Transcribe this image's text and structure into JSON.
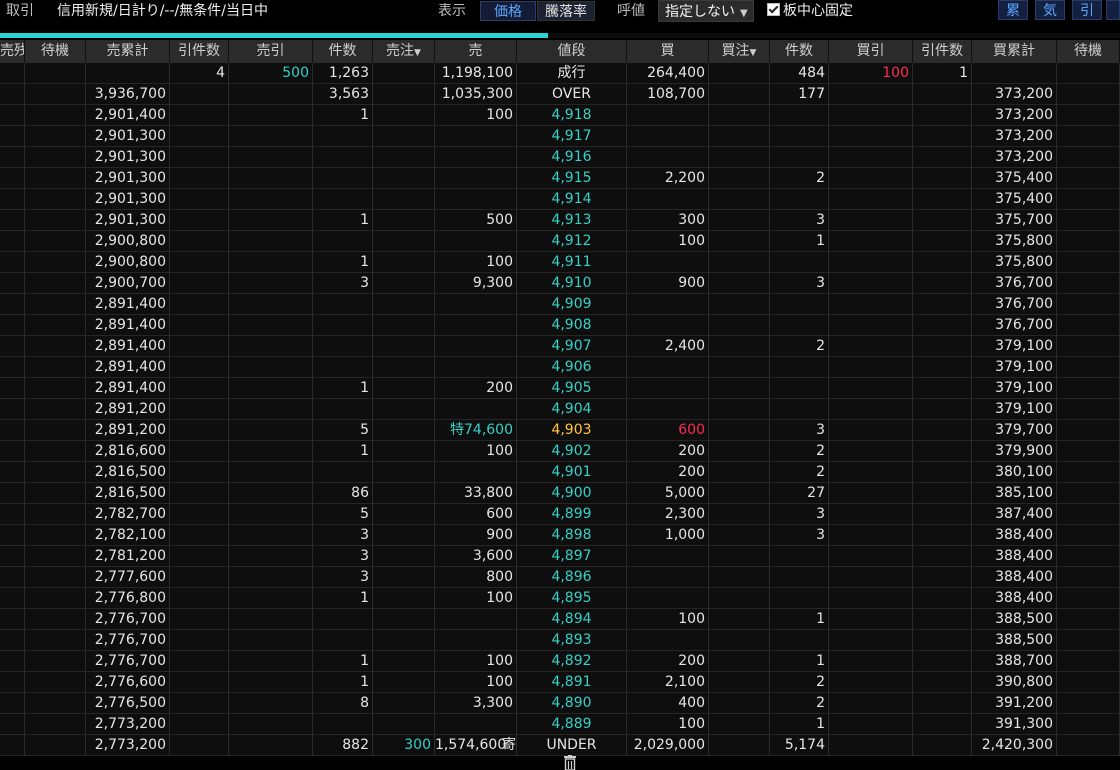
{
  "toolbar": {
    "trade_label": "取引",
    "trade_value": "信用新規/日計り/--/無条件/当日中",
    "display_label": "表示",
    "display_opt_price": "価格",
    "display_opt_rate": "騰落率",
    "tick_label": "呼値",
    "tick_value": "指定しない",
    "center_fix_label": "板中心固定",
    "btn_cumulative": "累",
    "btn_volume": "気",
    "btn_draw": "引"
  },
  "headers": {
    "sell_rest": "売残",
    "wait_l": "待機",
    "sell_cum": "売累計",
    "draw_count_l": "引件数",
    "sell_draw": "売引",
    "count_l": "件数",
    "sell_order": "売注",
    "sell": "売",
    "price": "値段",
    "buy": "買",
    "buy_order": "買注",
    "count_r": "件数",
    "buy_draw": "買引",
    "draw_count_r": "引件数",
    "buy_cum": "買累計",
    "wait_r": "待機"
  },
  "top_row": {
    "draw_count_l": "4",
    "sell_draw": "500",
    "count_l": "1,263",
    "sell": "1,198,100",
    "price": "成行",
    "buy": "264,400",
    "count_r": "484",
    "buy_draw": "100",
    "draw_count_r": "1"
  },
  "over_row": {
    "sell_cum": "3,936,700",
    "count_l": "3,563",
    "sell": "1,035,300",
    "price": "OVER",
    "buy": "108,700",
    "count_r": "177",
    "buy_cum": "373,200"
  },
  "levels": [
    {
      "sell_cum": "2,901,400",
      "count_l": "1",
      "sell": "100",
      "price": "4,918",
      "buy": "",
      "count_r": "",
      "buy_cum": "373,200"
    },
    {
      "sell_cum": "2,901,300",
      "count_l": "",
      "sell": "",
      "price": "4,917",
      "buy": "",
      "count_r": "",
      "buy_cum": "373,200"
    },
    {
      "sell_cum": "2,901,300",
      "count_l": "",
      "sell": "",
      "price": "4,916",
      "buy": "",
      "count_r": "",
      "buy_cum": "373,200"
    },
    {
      "sell_cum": "2,901,300",
      "count_l": "",
      "sell": "",
      "price": "4,915",
      "buy": "2,200",
      "count_r": "2",
      "buy_cum": "375,400"
    },
    {
      "sell_cum": "2,901,300",
      "count_l": "",
      "sell": "",
      "price": "4,914",
      "buy": "",
      "count_r": "",
      "buy_cum": "375,400"
    },
    {
      "sell_cum": "2,901,300",
      "count_l": "1",
      "sell": "500",
      "price": "4,913",
      "buy": "300",
      "count_r": "3",
      "buy_cum": "375,700"
    },
    {
      "sell_cum": "2,900,800",
      "count_l": "",
      "sell": "",
      "price": "4,912",
      "buy": "100",
      "count_r": "1",
      "buy_cum": "375,800"
    },
    {
      "sell_cum": "2,900,800",
      "count_l": "1",
      "sell": "100",
      "price": "4,911",
      "buy": "",
      "count_r": "",
      "buy_cum": "375,800"
    },
    {
      "sell_cum": "2,900,700",
      "count_l": "3",
      "sell": "9,300",
      "price": "4,910",
      "buy": "900",
      "count_r": "3",
      "buy_cum": "376,700"
    },
    {
      "sell_cum": "2,891,400",
      "count_l": "",
      "sell": "",
      "price": "4,909",
      "buy": "",
      "count_r": "",
      "buy_cum": "376,700"
    },
    {
      "sell_cum": "2,891,400",
      "count_l": "",
      "sell": "",
      "price": "4,908",
      "buy": "",
      "count_r": "",
      "buy_cum": "376,700"
    },
    {
      "sell_cum": "2,891,400",
      "count_l": "",
      "sell": "",
      "price": "4,907",
      "buy": "2,400",
      "count_r": "2",
      "buy_cum": "379,100"
    },
    {
      "sell_cum": "2,891,400",
      "count_l": "",
      "sell": "",
      "price": "4,906",
      "buy": "",
      "count_r": "",
      "buy_cum": "379,100"
    },
    {
      "sell_cum": "2,891,400",
      "count_l": "1",
      "sell": "200",
      "price": "4,905",
      "buy": "",
      "count_r": "",
      "buy_cum": "379,100"
    },
    {
      "sell_cum": "2,891,200",
      "count_l": "",
      "sell": "",
      "price": "4,904",
      "buy": "",
      "count_r": "",
      "buy_cum": "379,100"
    },
    {
      "sell_cum": "2,891,200",
      "count_l": "5",
      "sell": "特74,600",
      "price": "4,903",
      "buy": "600",
      "count_r": "3",
      "buy_cum": "379,700",
      "current": true
    },
    {
      "sell_cum": "2,816,600",
      "count_l": "1",
      "sell": "100",
      "price": "4,902",
      "buy": "200",
      "count_r": "2",
      "buy_cum": "379,900"
    },
    {
      "sell_cum": "2,816,500",
      "count_l": "",
      "sell": "",
      "price": "4,901",
      "buy": "200",
      "count_r": "2",
      "buy_cum": "380,100"
    },
    {
      "sell_cum": "2,816,500",
      "count_l": "86",
      "sell": "33,800",
      "price": "4,900",
      "buy": "5,000",
      "count_r": "27",
      "buy_cum": "385,100"
    },
    {
      "sell_cum": "2,782,700",
      "count_l": "5",
      "sell": "600",
      "price": "4,899",
      "buy": "2,300",
      "count_r": "3",
      "buy_cum": "387,400"
    },
    {
      "sell_cum": "2,782,100",
      "count_l": "3",
      "sell": "900",
      "price": "4,898",
      "buy": "1,000",
      "count_r": "3",
      "buy_cum": "388,400"
    },
    {
      "sell_cum": "2,781,200",
      "count_l": "3",
      "sell": "3,600",
      "price": "4,897",
      "buy": "",
      "count_r": "",
      "buy_cum": "388,400"
    },
    {
      "sell_cum": "2,777,600",
      "count_l": "3",
      "sell": "800",
      "price": "4,896",
      "buy": "",
      "count_r": "",
      "buy_cum": "388,400"
    },
    {
      "sell_cum": "2,776,800",
      "count_l": "1",
      "sell": "100",
      "price": "4,895",
      "buy": "",
      "count_r": "",
      "buy_cum": "388,400"
    },
    {
      "sell_cum": "2,776,700",
      "count_l": "",
      "sell": "",
      "price": "4,894",
      "buy": "100",
      "count_r": "1",
      "buy_cum": "388,500"
    },
    {
      "sell_cum": "2,776,700",
      "count_l": "",
      "sell": "",
      "price": "4,893",
      "buy": "",
      "count_r": "",
      "buy_cum": "388,500"
    },
    {
      "sell_cum": "2,776,700",
      "count_l": "1",
      "sell": "100",
      "price": "4,892",
      "buy": "200",
      "count_r": "1",
      "buy_cum": "388,700"
    },
    {
      "sell_cum": "2,776,600",
      "count_l": "1",
      "sell": "100",
      "price": "4,891",
      "buy": "2,100",
      "count_r": "2",
      "buy_cum": "390,800"
    },
    {
      "sell_cum": "2,776,500",
      "count_l": "8",
      "sell": "3,300",
      "price": "4,890",
      "buy": "400",
      "count_r": "2",
      "buy_cum": "391,200"
    },
    {
      "sell_cum": "2,773,200",
      "count_l": "",
      "sell": "",
      "price": "4,889",
      "buy": "100",
      "count_r": "1",
      "buy_cum": "391,300"
    }
  ],
  "under_row": {
    "sell_cum": "2,773,200",
    "count_l": "882",
    "sell_order": "300",
    "sell": "1,574,600",
    "sell_suffix": "寄",
    "price": "UNDER",
    "buy": "2,029,000",
    "count_r": "5,174",
    "buy_cum": "2,420,300"
  },
  "colors": {
    "price_cyan": "#36d0c6",
    "current_yellow": "#ffc63a",
    "alert_red": "#ff2a55",
    "accent_blue": "#5aa7ff",
    "progress_cyan": "#2ad3d6"
  }
}
